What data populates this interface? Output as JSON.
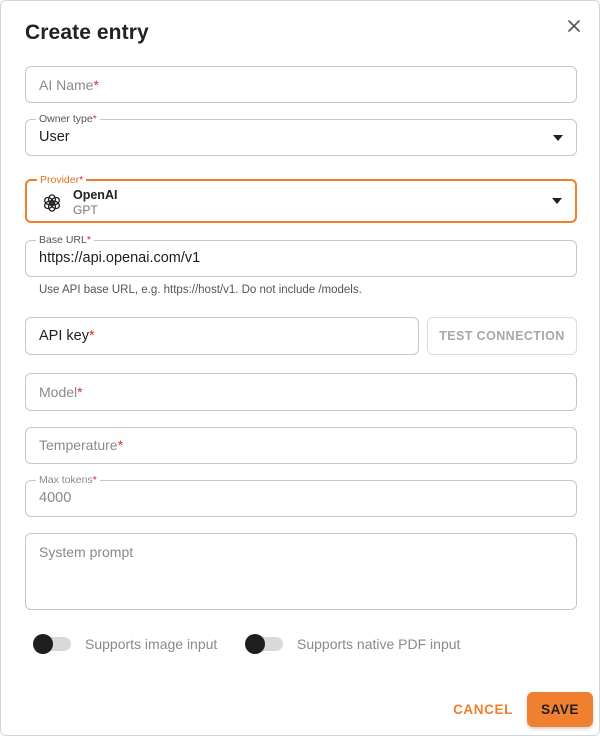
{
  "dialog": {
    "title": "Create entry",
    "close_icon": "close-icon"
  },
  "fields": {
    "ai_name": {
      "placeholder": "AI Name",
      "required": "*"
    },
    "owner_type": {
      "label": "Owner type",
      "required": "*",
      "value": "User"
    },
    "provider": {
      "label": "Provider",
      "required": "*",
      "name": "OpenAI",
      "subtitle": "GPT",
      "icon": "openai-icon"
    },
    "base_url": {
      "label": "Base URL",
      "required": "*",
      "value": "https://api.openai.com/v1",
      "helper": "Use API base URL, e.g. https://host/v1. Do not include /models."
    },
    "api_key": {
      "placeholder": "API key",
      "required": "*"
    },
    "model": {
      "placeholder": "Model",
      "required": "*"
    },
    "temperature": {
      "placeholder": "Temperature",
      "required": "*"
    },
    "max_tokens": {
      "label": "Max tokens",
      "required": "*",
      "value": "4000"
    },
    "system_prompt": {
      "placeholder": "System prompt"
    }
  },
  "buttons": {
    "test_connection": "TEST CONNECTION",
    "cancel": "CANCEL",
    "save": "SAVE"
  },
  "toggles": {
    "image_input": {
      "label": "Supports image input",
      "on": false
    },
    "pdf_input": {
      "label": "Supports native PDF input",
      "on": false
    }
  },
  "colors": {
    "accent": "#f07f2a",
    "required": "#d32f2f",
    "border": "#c7c7c7"
  }
}
